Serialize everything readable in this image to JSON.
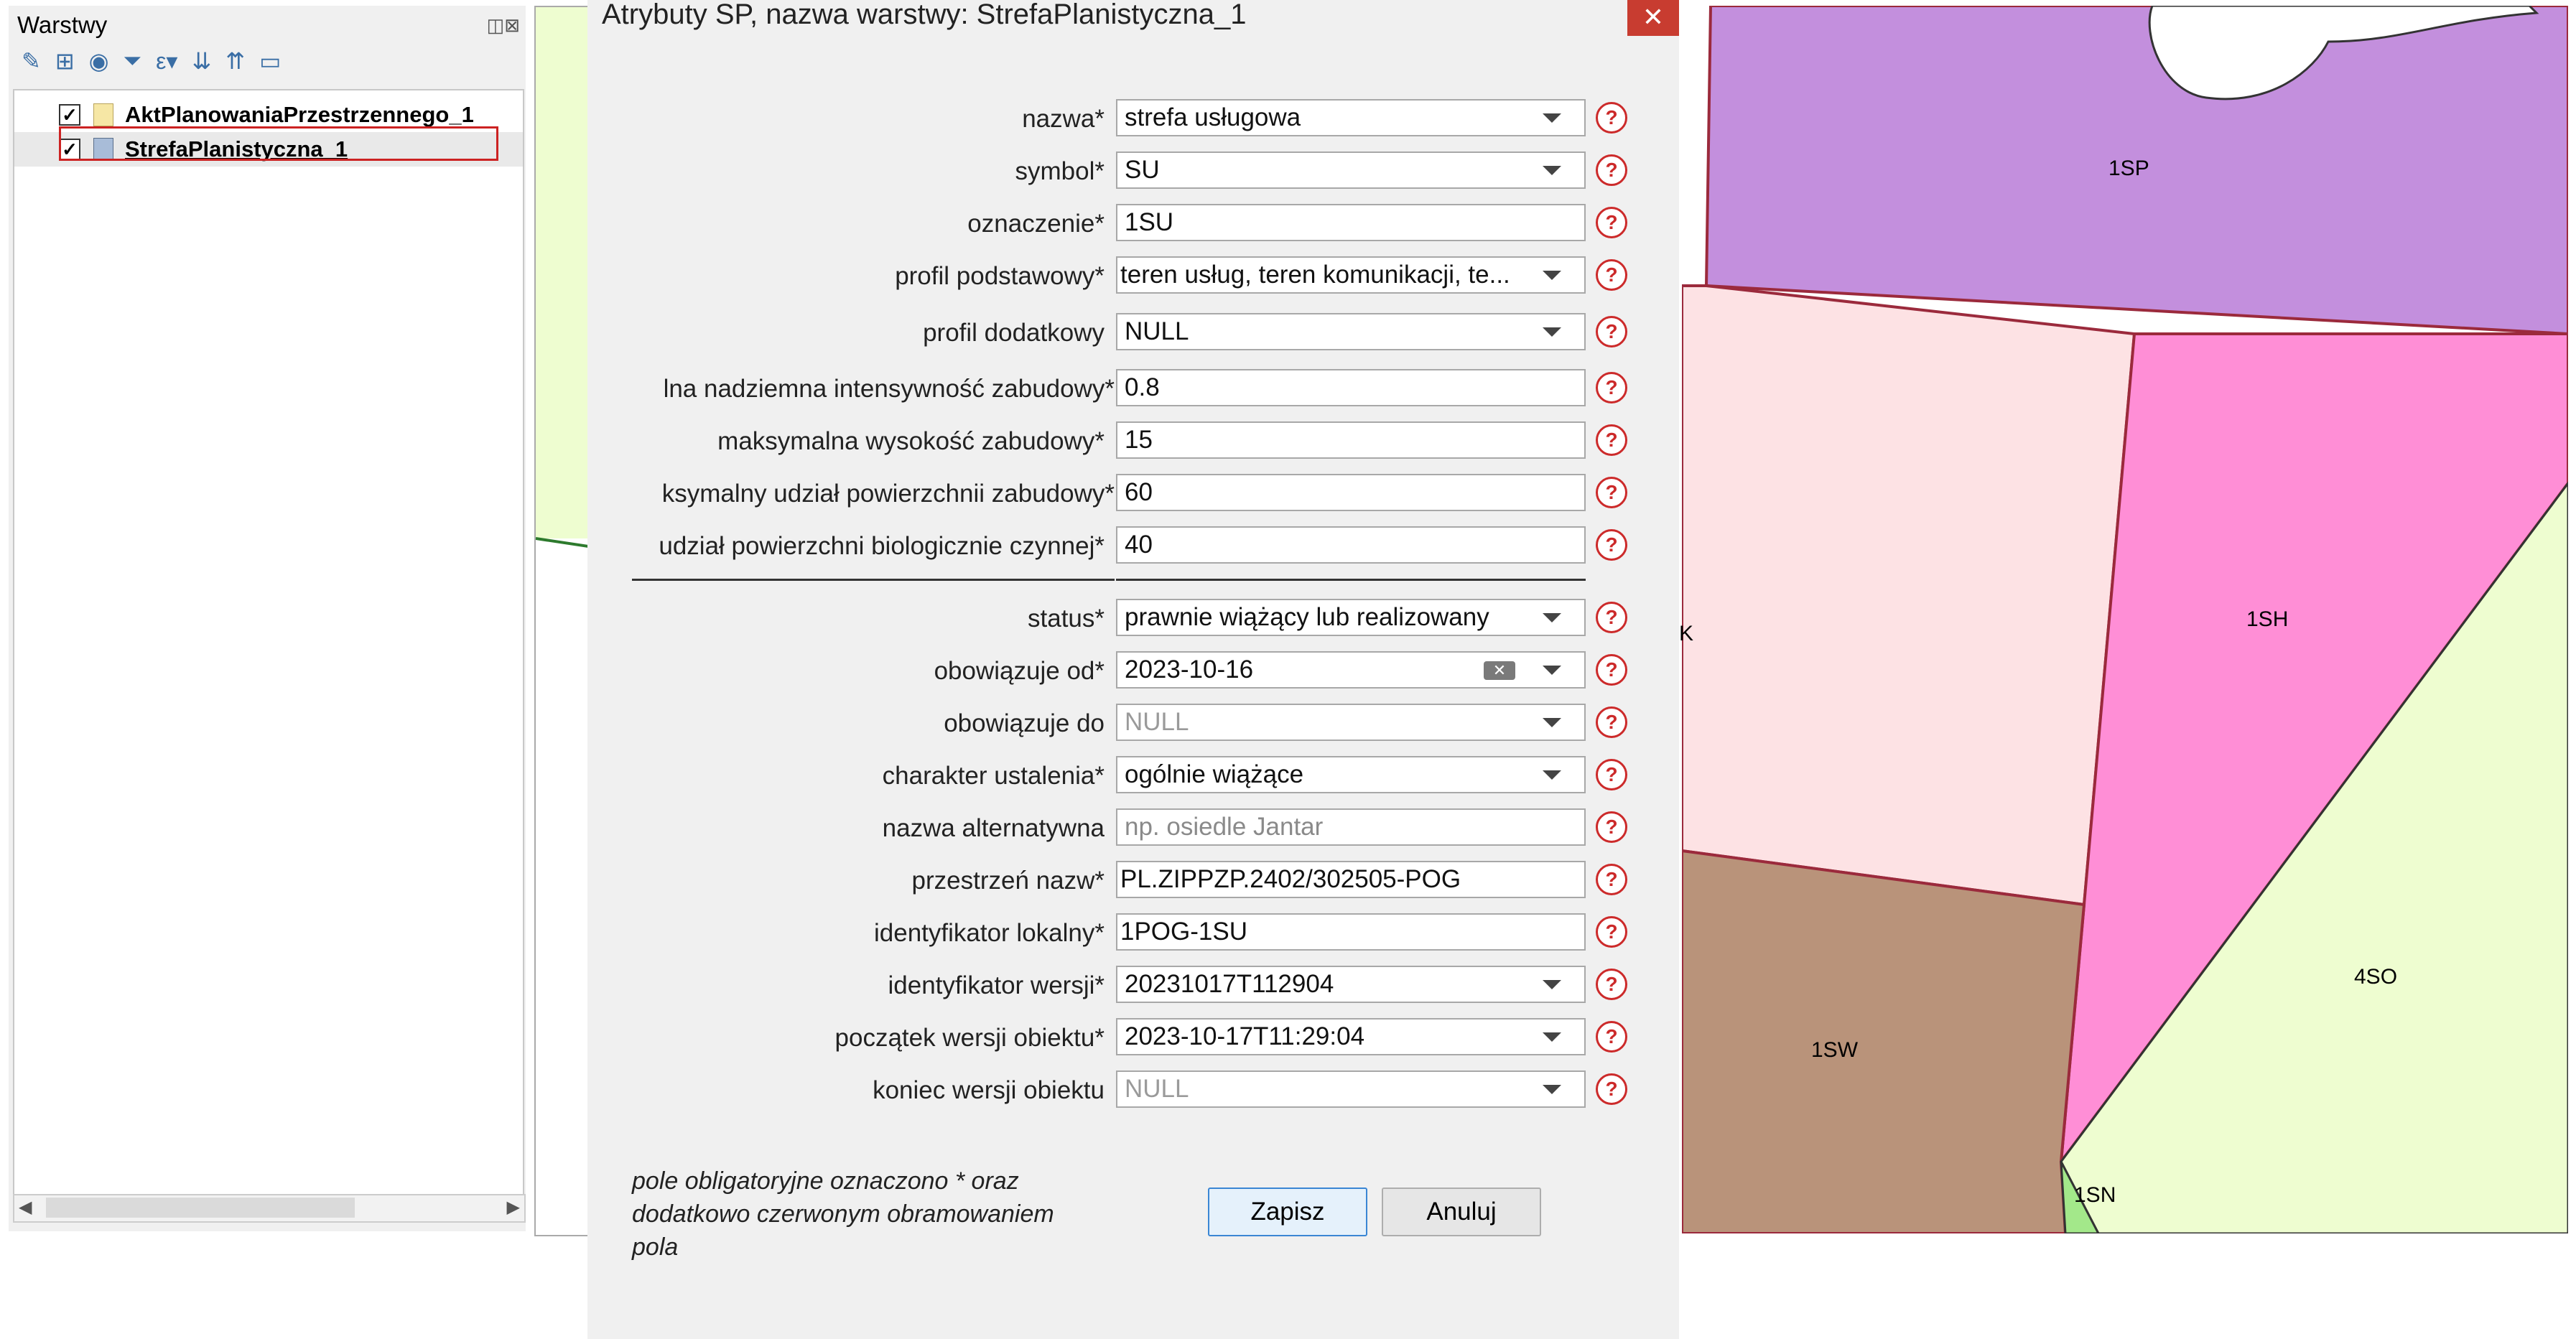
{
  "layers_panel": {
    "title": "Warstwy",
    "controls": "◫⊠",
    "layers": [
      {
        "check": "✓",
        "name": "AktPlanowaniaPrzestrzennego_1"
      },
      {
        "check": "✓",
        "name": "StrefaPlanistyczna_1"
      }
    ]
  },
  "map": {
    "labels": {
      "sp": "1SP",
      "sh": "1SH",
      "sw": "1SW",
      "so": "4SO",
      "sn": "1SN",
      "k": "K"
    }
  },
  "dialog": {
    "title": "Atrybuty SP, nazwa warstwy: StrefaPlanistyczna_1",
    "close": "✕",
    "fields": {
      "nazwa": {
        "label": "nazwa*",
        "value": "strefa usługowa"
      },
      "symbol": {
        "label": "symbol*",
        "value": "SU"
      },
      "oznaczenie": {
        "label": "oznaczenie*",
        "value": "1SU"
      },
      "profil_podstawowy": {
        "label": "profil podstawowy*",
        "value": "teren usług, teren komunikacji, te..."
      },
      "profil_dodatkowy": {
        "label": "profil dodatkowy",
        "value": "NULL"
      },
      "intensywnosc": {
        "label": "lna nadziemna intensywność zabudowy*",
        "value": "0.8"
      },
      "wysokosc": {
        "label": "maksymalna wysokość zabudowy*",
        "value": "15"
      },
      "udzial_zabudowy": {
        "label": "ksymalny udział powierzchnii zabudowy*",
        "value": "60"
      },
      "udzial_bio": {
        "label": "udział powierzchni biologicznie czynnej*",
        "value": "40"
      },
      "status": {
        "label": "status*",
        "value": "prawnie wiążący lub realizowany"
      },
      "obowiazuje_od": {
        "label": "obowiązuje od*",
        "value": "2023-10-16"
      },
      "obowiazuje_do": {
        "label": "obowiązuje do",
        "value": "NULL"
      },
      "charakter": {
        "label": "charakter ustalenia*",
        "value": "ogólnie wiążące"
      },
      "nazwa_alt": {
        "label": "nazwa alternatywna",
        "placeholder": "np. osiedle Jantar"
      },
      "przestrzen_nazw": {
        "label": "przestrzeń nazw*",
        "value": "PL.ZIPPZP.2402/302505-POG"
      },
      "id_lokalny": {
        "label": "identyfikator lokalny*",
        "value": "1POG-1SU"
      },
      "id_wersji": {
        "label": "identyfikator wersji*",
        "value": "20231017T112904"
      },
      "poczatek_wersji": {
        "label": "początek wersji obiektu*",
        "value": "2023-10-17T11:29:04"
      },
      "koniec_wersji": {
        "label": "koniec wersji obiektu",
        "value": "NULL"
      }
    },
    "help_glyph": "?",
    "clear_glyph": "✕",
    "note": "pole obligatoryjne oznaczono * oraz dodatkowo czerwonym obramowaniem pola",
    "buttons": {
      "save": "Zapisz",
      "cancel": "Anuluj"
    }
  },
  "colors": {
    "purple_zone": "#c38fdd",
    "light_pink_zone": "#fde2e4",
    "pink_zone": "#ff8ed6",
    "brown_zone": "#b9937a",
    "light_green_zone": "#eefdd0",
    "green_zone": "#a3e88a",
    "zone_border": "#9b2a3c",
    "help_red": "#cc2a2a"
  }
}
